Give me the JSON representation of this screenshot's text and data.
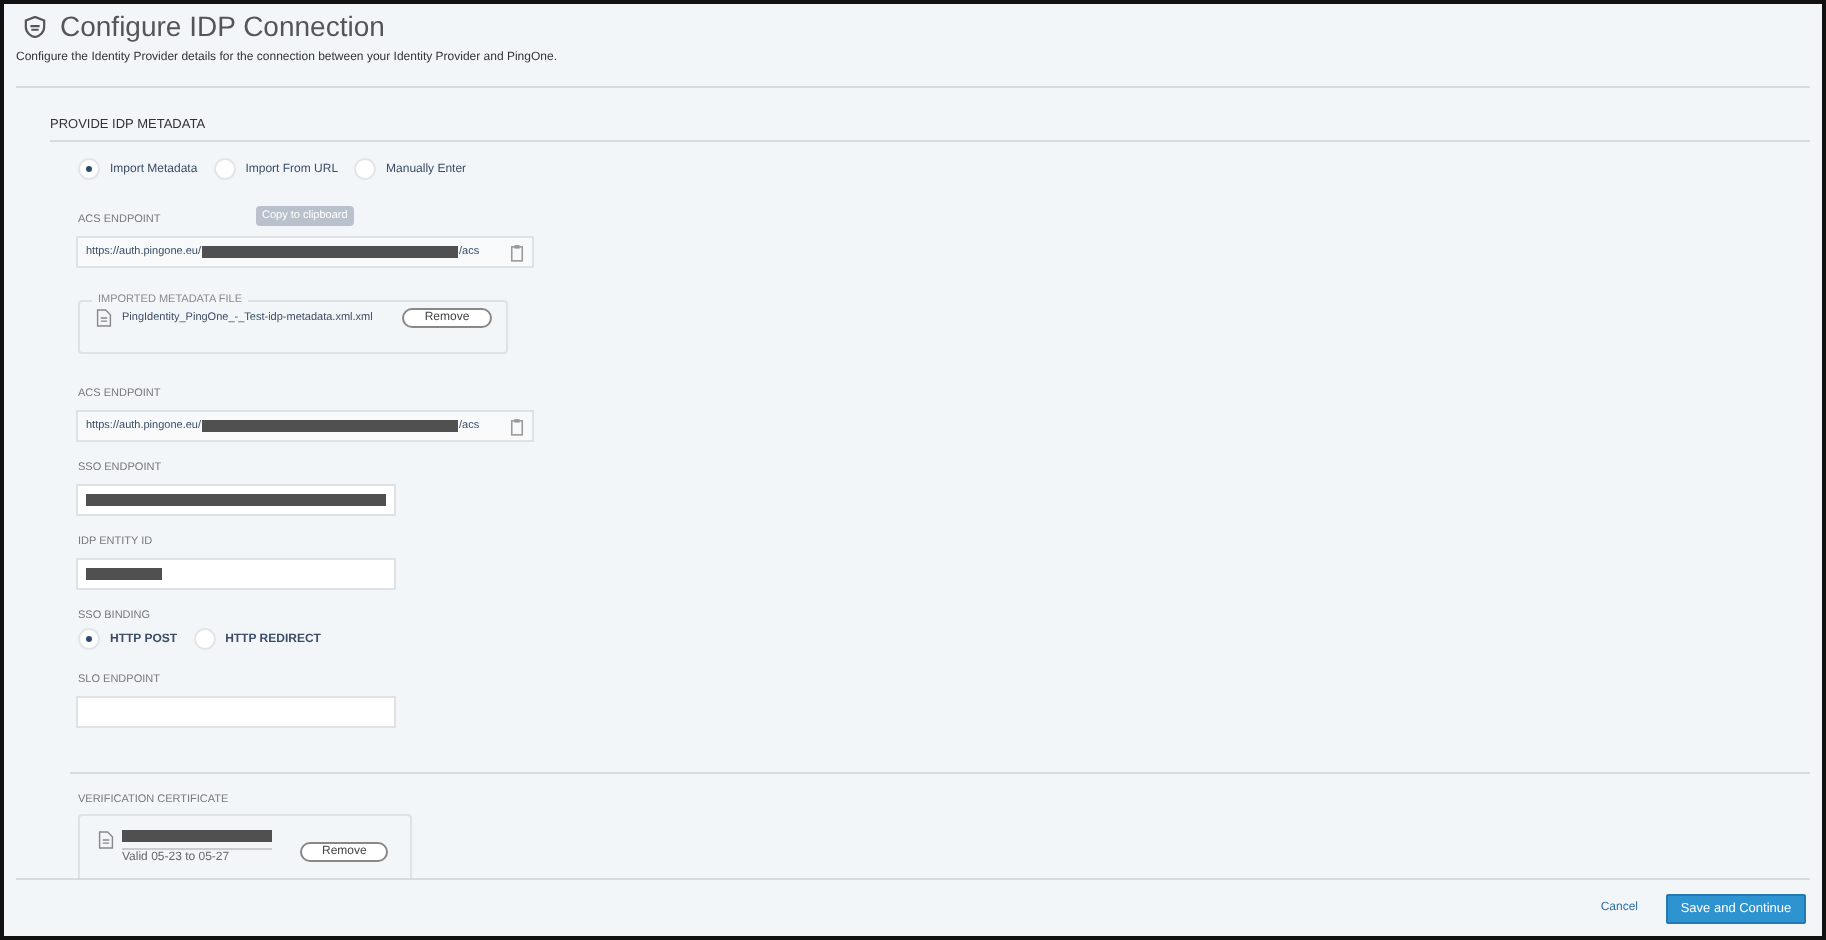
{
  "header": {
    "title": "Configure IDP Connection",
    "subtitle": "Configure the Identity Provider details for the connection between your Identity Provider and PingOne."
  },
  "section_title": "PROVIDE IDP METADATA",
  "metadata_options": [
    {
      "label": "Import Metadata",
      "selected": true
    },
    {
      "label": "Import From URL",
      "selected": false
    },
    {
      "label": "Manually Enter",
      "selected": false
    }
  ],
  "acs_endpoint_1": {
    "label": "ACS ENDPOINT",
    "prefix": "https://auth.pingone.eu/",
    "redacted": true,
    "suffix": "/acs",
    "tooltip": "Copy to clipboard"
  },
  "imported_file": {
    "legend": "IMPORTED METADATA FILE",
    "file_name": "PingIdentity_PingOne_-_Test-idp-metadata.xml.xml",
    "button": "Remove"
  },
  "acs_endpoint_2": {
    "label": "ACS ENDPOINT",
    "prefix": "https://auth.pingone.eu/",
    "redacted": true,
    "suffix": "/acs"
  },
  "sso_endpoint": {
    "label": "SSO ENDPOINT",
    "redacted": true
  },
  "idp_entity_id": {
    "label": "IDP ENTITY ID",
    "redacted": true
  },
  "sso_binding": {
    "label": "SSO BINDING",
    "options": [
      {
        "label": "HTTP POST",
        "selected": true
      },
      {
        "label": "HTTP REDIRECT",
        "selected": false
      }
    ]
  },
  "slo_endpoint": {
    "label": "SLO ENDPOINT"
  },
  "verification_certificate": {
    "label": "VERIFICATION CERTIFICATE",
    "redacted": true,
    "validity": "Valid 05-23 to 05-27",
    "button": "Remove"
  },
  "footer": {
    "cancel": "Cancel",
    "primary": "Save and Continue"
  }
}
